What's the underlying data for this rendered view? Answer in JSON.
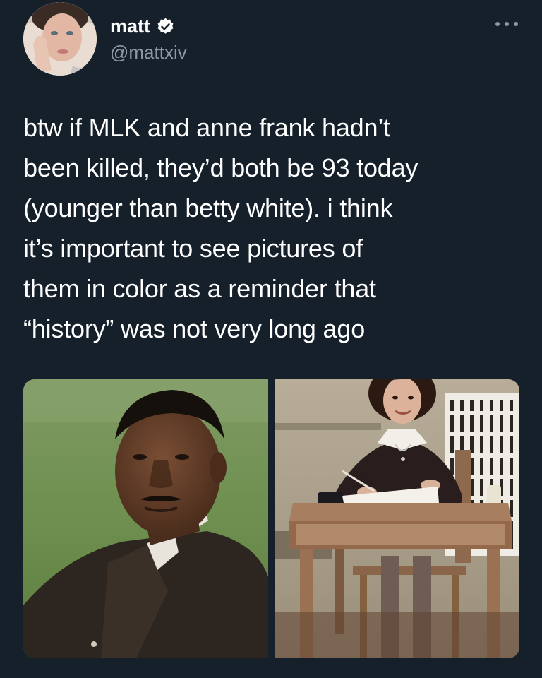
{
  "tweet": {
    "author": {
      "display_name": "matt",
      "handle": "@mattxiv",
      "verified": true
    },
    "more_icon": "more-horizontal-icon",
    "text_lines": [
      "btw if MLK and anne frank hadn’t",
      "been killed, they’d both be 93 today",
      "(younger than betty white). i think",
      "it’s important to see pictures of",
      "them in color as a reminder that",
      "“history” was not very long ago"
    ],
    "media": [
      {
        "description_name": "photo-mlk"
      },
      {
        "description_name": "photo-anne-frank"
      }
    ]
  },
  "colors": {
    "background": "#15202b",
    "text": "#ffffff",
    "secondary_text": "#8b98a5",
    "verified_badge": "#ffffff"
  }
}
